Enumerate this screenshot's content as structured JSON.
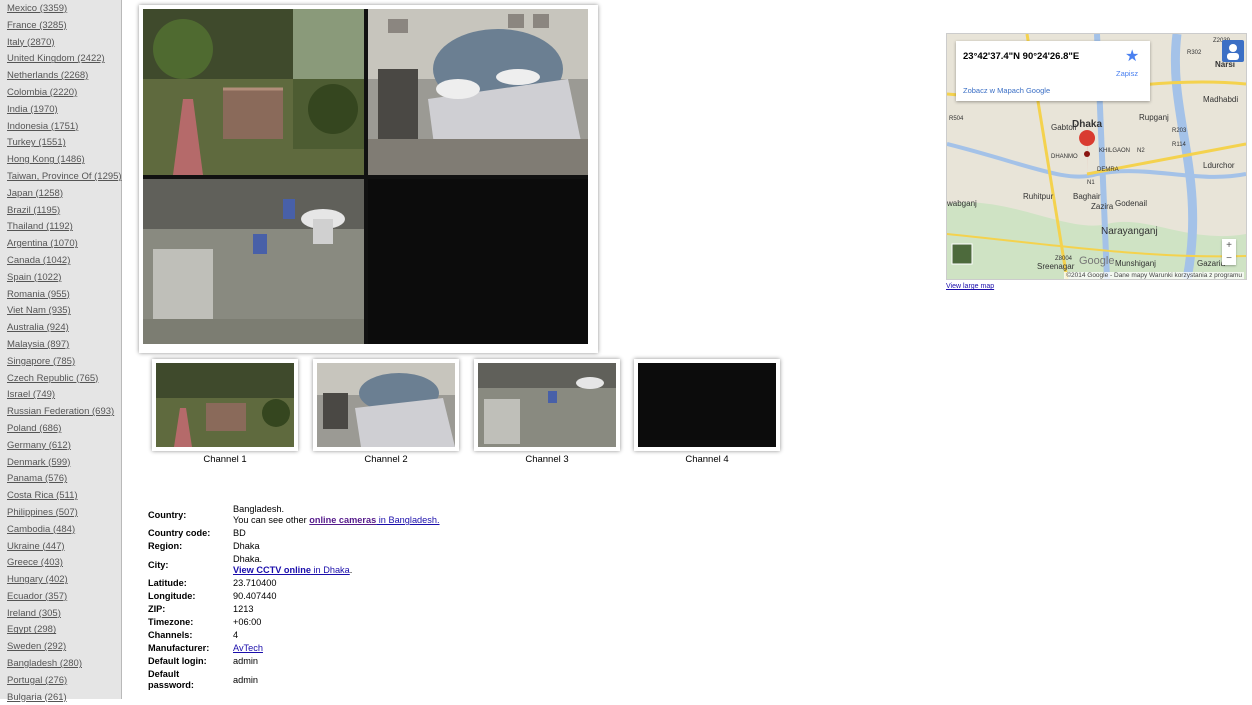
{
  "sidebar": {
    "countries": [
      "Mexico (3359)",
      "France (3285)",
      "Italy (2870)",
      "United Kingdom (2422)",
      "Netherlands (2268)",
      "Colombia (2220)",
      "India (1970)",
      "Indonesia (1751)",
      "Turkey (1551)",
      "Hong Kong (1486)",
      "Taiwan, Province Of (1295)",
      "Japan (1258)",
      "Brazil (1195)",
      "Thailand (1192)",
      "Argentina (1070)",
      "Canada (1042)",
      "Spain (1022)",
      "Romania (955)",
      "Viet Nam (935)",
      "Australia (924)",
      "Malaysia (897)",
      "Singapore (785)",
      "Czech Republic (765)",
      "Israel (749)",
      "Russian Federation (693)",
      "Poland (686)",
      "Germany (612)",
      "Denmark (599)",
      "Panama (576)",
      "Costa Rica (511)",
      "Philippines (507)",
      "Cambodia (484)",
      "Ukraine (447)",
      "Greece (403)",
      "Hungary (402)",
      "Ecuador (357)",
      "Ireland (305)",
      "Egypt (298)",
      "Sweden (292)",
      "Bangladesh (280)",
      "Portugal (276)",
      "Bulgaria (261)"
    ]
  },
  "thumbnails": [
    "Channel 1",
    "Channel 2",
    "Channel 3",
    "Channel 4"
  ],
  "info": {
    "country_label": "Country:",
    "country_value": "Bangladesh.",
    "country_note_pre": "You can see other ",
    "country_link": "online cameras",
    "country_note_post": " in Bangladesh.",
    "country_code_label": "Country code:",
    "country_code": "BD",
    "region_label": "Region:",
    "region": "Dhaka",
    "city_label": "City:",
    "city": "Dhaka.",
    "city_link": "View CCTV online",
    "city_link_post": " in Dhaka",
    "latitude_label": "Latitude:",
    "latitude": "23.710400",
    "longitude_label": "Longitude:",
    "longitude": "90.407440",
    "zip_label": "ZIP:",
    "zip": "1213",
    "timezone_label": "Timezone:",
    "timezone": "+06:00",
    "channels_label": "Channels:",
    "channels": "4",
    "manufacturer_label": "Manufacturer:",
    "manufacturer": "AvTech",
    "login_label": "Default login:",
    "login": "admin",
    "password_label": "Default password:",
    "password": "admin"
  },
  "map": {
    "coords": "23°42'37.4\"N 90°24'26.8\"E",
    "save": "Zapisz",
    "view_in_gmaps": "Zobacz w Mapach Google",
    "attribution": "©2014 Google - Dane mapy  Warunki korzystania z programu",
    "zoom_in": "+",
    "zoom_out": "−",
    "view_large": "View large map",
    "logo": "Google",
    "places": [
      "Dhaka",
      "Gabtoli",
      "DHANMO",
      "KHILGAON",
      "DEMRA",
      "Rupganj",
      "Madhabdi",
      "Narsi",
      "Ruhitpur",
      "Baghair",
      "Godenail",
      "Zazira",
      "Narayanganj",
      "Munshiganj",
      "Gazaria",
      "Ldurchor",
      "Sreenagar",
      "wabganj",
      "R504",
      "R302",
      "R203",
      "R114",
      "N2",
      "N1",
      "Z8004",
      "Z2039"
    ]
  }
}
